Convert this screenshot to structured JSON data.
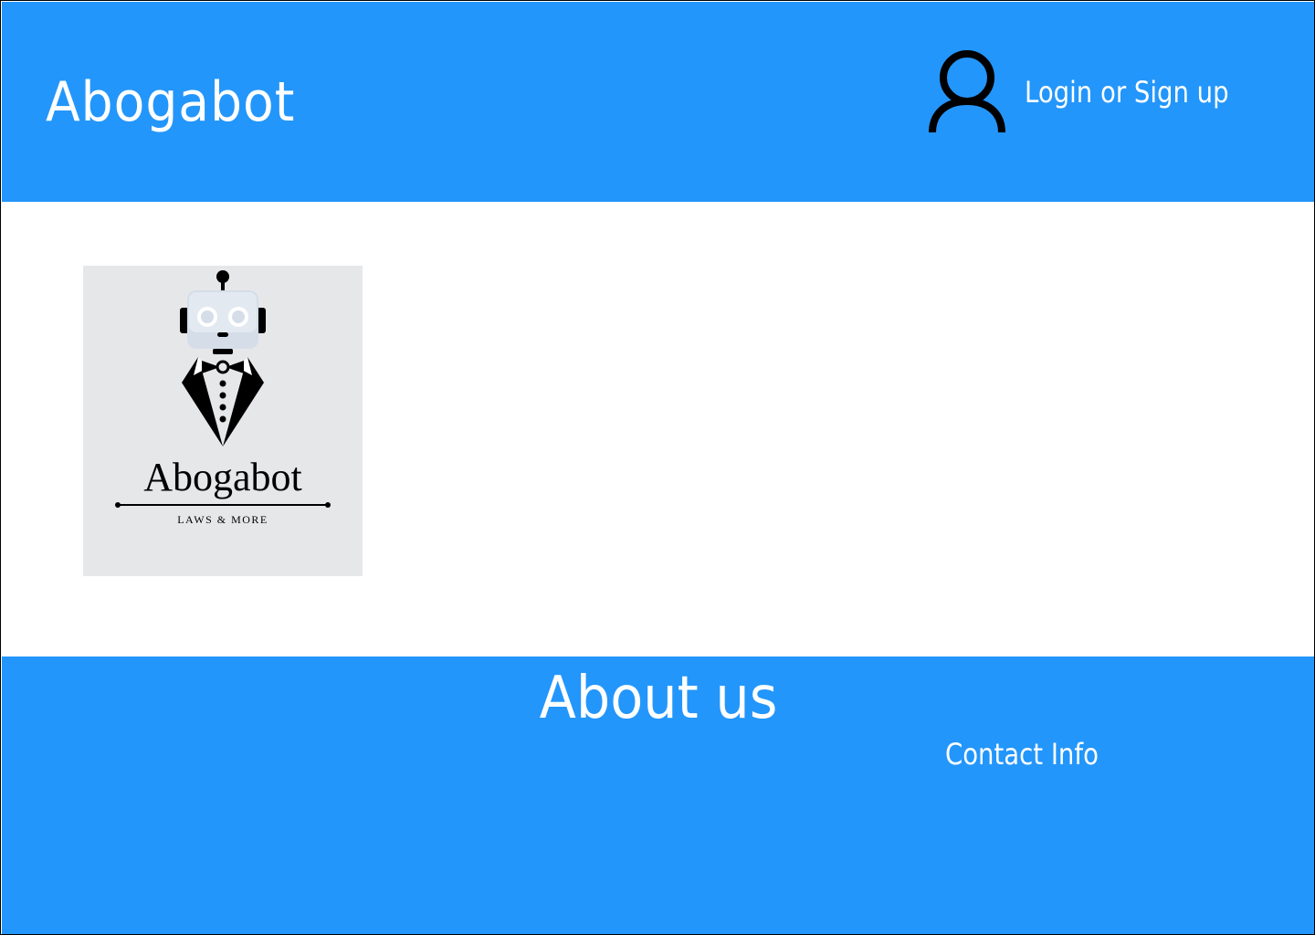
{
  "header": {
    "title": "Abogabot",
    "login_label": "Login or Sign up",
    "user_icon": "user-icon"
  },
  "logo": {
    "name": "Abogabot",
    "tagline": "LAWS & MORE",
    "icon": "robot-in-tuxedo-logo"
  },
  "footer": {
    "about_title": "About us",
    "contact_label": "Contact Info"
  },
  "colors": {
    "brand_blue": "#2396fb",
    "text_white": "#ffffff",
    "logo_bg": "#e6e7e9"
  }
}
